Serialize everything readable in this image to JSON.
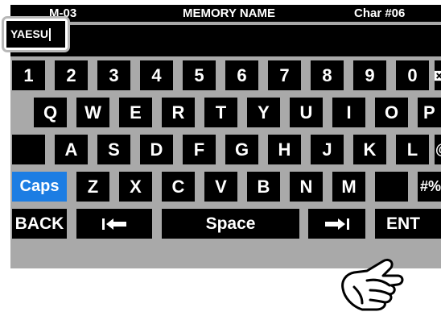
{
  "header": {
    "left": "M-03",
    "title": "MEMORY NAME",
    "char_counter": "Char #06"
  },
  "input": {
    "value": "YAESU"
  },
  "keyboard": {
    "row1": [
      "1",
      "2",
      "3",
      "4",
      "5",
      "6",
      "7",
      "8",
      "9",
      "0"
    ],
    "row2": [
      "Q",
      "W",
      "E",
      "R",
      "T",
      "Y",
      "U",
      "I",
      "O",
      "P"
    ],
    "row3": [
      "A",
      "S",
      "D",
      "F",
      "G",
      "H",
      "J",
      "K",
      "L",
      "@"
    ],
    "row4": [
      "Z",
      "X",
      "C",
      "V",
      "B",
      "N",
      "M"
    ],
    "caps_label": "Caps",
    "symbols_label": "#%^",
    "back_label": "BACK",
    "space_label": "Space",
    "ent_label": "ENT"
  },
  "icons": {
    "backspace": "backspace-icon",
    "cursor_left": "cursor-left-icon",
    "cursor_right": "cursor-right-icon",
    "pointing_hand": "pointing-hand-icon"
  },
  "colors": {
    "caps_active": "#1c7de3",
    "key_bg": "#000000",
    "panel": "#a9a9a9"
  }
}
